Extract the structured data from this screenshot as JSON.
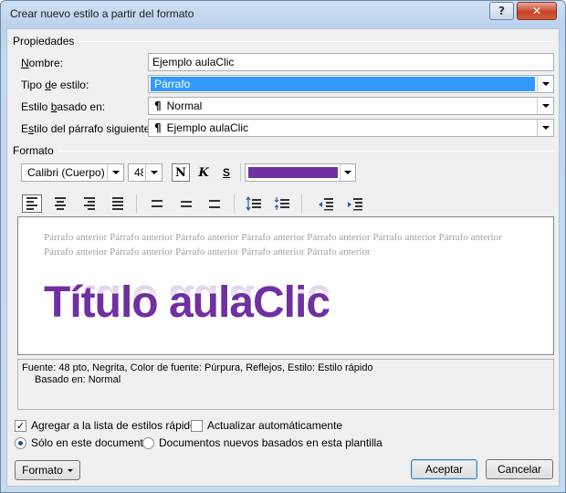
{
  "window": {
    "title": "Crear nuevo estilo a partir del formato",
    "help_glyph": "?",
    "close_glyph": "✕"
  },
  "properties": {
    "group_label": "Propiedades",
    "name_label": "Nombre:",
    "name_value": "Ejemplo aulaClic",
    "type_label": "Tipo de estilo:",
    "type_value": "Párrafo",
    "based_label": "Estilo basado en:",
    "based_value": "Normal",
    "next_label": "Estilo del párrafo siguiente:",
    "next_value": "Ejemplo aulaClic",
    "para_glyph": "¶"
  },
  "format": {
    "group_label": "Formato",
    "font": "Calibri (Cuerpo)",
    "size": "48",
    "bold_label": "N",
    "italic_label": "K",
    "underline_label": "S",
    "font_color": "#7030a0"
  },
  "preview": {
    "previous_text": "Párrafo anterior Párrafo anterior Párrafo anterior Párrafo anterior Párrafo anterior Párrafo anterior Párrafo anterior Párrafo anterior Párrafo anterior Párrafo anterior Párrafo anterior Párrafo anterior",
    "title": "Título aulaClic"
  },
  "description": {
    "line1": "Fuente: 48 pto, Negrita, Color de fuente: Púrpura, Reflejos, Estilo: Estilo rápido",
    "line2": "Basado en: Normal"
  },
  "options": {
    "add_quick_styles": {
      "label": "Agregar a la lista de estilos rápidos",
      "checked": true,
      "check_glyph": "✓"
    },
    "auto_update": {
      "label": "Actualizar automáticamente",
      "checked": false
    },
    "only_this_doc": {
      "label": "Sólo en este documento",
      "selected": true
    },
    "new_docs": {
      "label": "Documentos nuevos basados en esta plantilla",
      "selected": false
    }
  },
  "buttons": {
    "format": "Formato",
    "accept": "Aceptar",
    "cancel": "Cancelar"
  }
}
